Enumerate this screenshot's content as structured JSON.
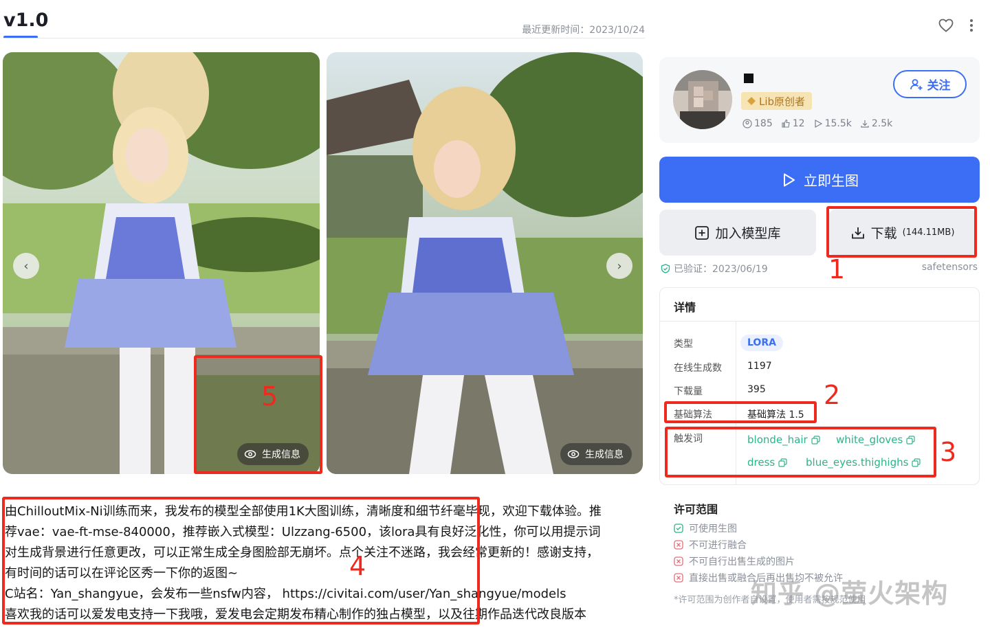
{
  "header": {
    "version": "v1.0",
    "updated": "最近更新时间：2023/10/24"
  },
  "gallery": {
    "gen_info_label": "生成信息"
  },
  "annotations": [
    "1",
    "2",
    "3",
    "4",
    "5"
  ],
  "description": {
    "lines": [
      "由ChilloutMix-Ni训练而来，我发布的模型全部使用1K大图训练，清晰度和细节纤毫毕现，欢迎下载体验。推",
      "荐vae：vae-ft-mse-840000，推荐嵌入式模型：Ulzzang-6500，该lora具有良好泛化性，你可以用提示词",
      "对生成背景进行任意更改，可以正常生成全身图脸部无崩坏。点个关注不迷路，我会经常更新的！感谢支持，",
      "有时间的话可以在评论区秀一下你的返图~",
      "C站名：Yan_shangyue，会发布一些nsfw内容， https://civitai.com/user/Yan_shangyue/models",
      "喜欢我的话可以爱发电支持一下我哦，爱发电会定期发布精心制作的独占模型，以及往期作品迭代改良版本"
    ]
  },
  "author": {
    "badge": "Lib原创者",
    "stats": [
      "185",
      "12",
      "15.5k",
      "2.5k"
    ],
    "follow_label": "关注"
  },
  "actions": {
    "generate_label": "立即生图",
    "add_library_label": "加入模型库",
    "download_label": "下载",
    "download_size": "(144.11MB)",
    "verified": "已验证：2023/06/19",
    "format": "safetensors"
  },
  "details": {
    "title": "详情",
    "rows": [
      {
        "label": "类型",
        "value": "LORA"
      },
      {
        "label": "在线生成数",
        "value": "1197"
      },
      {
        "label": "下载量",
        "value": "395"
      },
      {
        "label": "基础算法",
        "value": "基础算法 1.5"
      },
      {
        "label": "触发词",
        "value": ""
      }
    ],
    "tags": [
      "blonde_hair",
      "white_gloves",
      "dress",
      "blue_eyes.thighighs"
    ]
  },
  "license": {
    "title": "许可范围",
    "items": [
      "可使用生图",
      "不可进行融合",
      "不可自行出售生成的图片",
      "直接出售或融合后再出售均不被允许"
    ],
    "note": "*许可范围为创作者自设置，使用者需按规范使用"
  },
  "watermark": "知乎 @萤火架构",
  "colors": {
    "accent": "#3b6ef5",
    "annotation_red": "#ee2a1f",
    "tag_green": "#2bb38a",
    "badge_gold": "#f7e4b5"
  }
}
